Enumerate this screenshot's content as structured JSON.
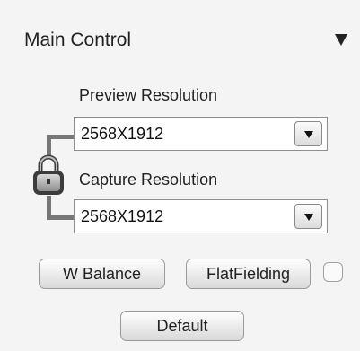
{
  "panel": {
    "title": "Main Control",
    "collapse_icon": "triangle-down-icon"
  },
  "resolution": {
    "lock_icon": "padlock-icon",
    "preview": {
      "label": "Preview Resolution",
      "value": "2568X1912"
    },
    "capture": {
      "label": "Capture Resolution",
      "value": "2568X1912"
    }
  },
  "buttons": {
    "white_balance": "W Balance",
    "flat_fielding": "FlatFielding",
    "default": "Default"
  },
  "flat_fielding_enabled": false
}
